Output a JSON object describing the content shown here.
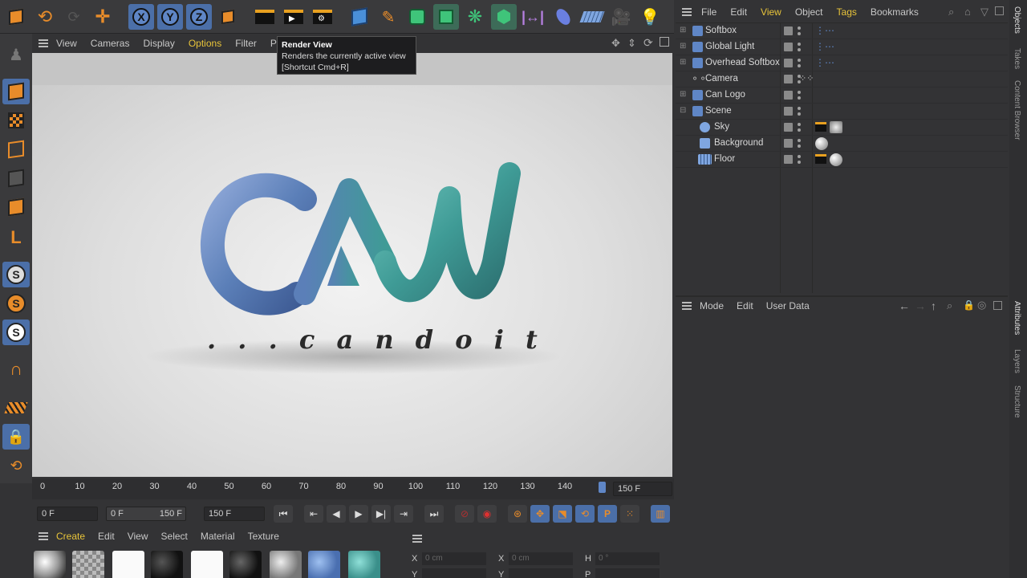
{
  "viewport_menu": [
    "View",
    "Cameras",
    "Display",
    "Options",
    "Filter",
    "Panel"
  ],
  "viewport_menu_active": "Options",
  "tooltip": {
    "title": "Render View",
    "desc": "Renders the currently active view",
    "shortcut": "[Shortcut Cmd+R]"
  },
  "scene_text": {
    "logo": "CAW",
    "tagline": ". . . c a n   d o   i t"
  },
  "timeline": {
    "ticks": [
      "0",
      "10",
      "20",
      "30",
      "40",
      "50",
      "60",
      "70",
      "80",
      "90",
      "100",
      "110",
      "120",
      "130",
      "140",
      "1"
    ],
    "end_field": "150 F"
  },
  "playbar": {
    "current": "0 F",
    "range_start": "0 F",
    "range_end": "150 F",
    "max": "150 F"
  },
  "material_menu": [
    "Create",
    "Edit",
    "View",
    "Select",
    "Material",
    "Texture"
  ],
  "material_menu_active": "Create",
  "coords": {
    "x_label": "X",
    "x_pos": "0 cm",
    "x_size": "0 cm",
    "h_label": "H",
    "h_rot": "0 °",
    "y_label": "Y",
    "p_label": "P"
  },
  "object_menu": [
    "File",
    "Edit",
    "View",
    "Object",
    "Tags",
    "Bookmarks"
  ],
  "object_menu_active": [
    "View",
    "Tags"
  ],
  "objects": [
    {
      "name": "Softbox"
    },
    {
      "name": "Global Light"
    },
    {
      "name": "Overhead Softbox"
    },
    {
      "name": "Camera"
    },
    {
      "name": "Can Logo"
    },
    {
      "name": "Scene"
    },
    {
      "name": "Sky"
    },
    {
      "name": "Background"
    },
    {
      "name": "Floor"
    }
  ],
  "attributes_menu": [
    "Mode",
    "Edit",
    "User Data"
  ],
  "right_tabs": [
    "Objects",
    "Takes",
    "Content Browser",
    "Attributes",
    "Layers",
    "Structure"
  ],
  "colors": {
    "accent": "#e8c43a",
    "selection": "#4b6fa8",
    "logo_blue": "#5b7fb8",
    "logo_teal": "#3f9b96"
  }
}
